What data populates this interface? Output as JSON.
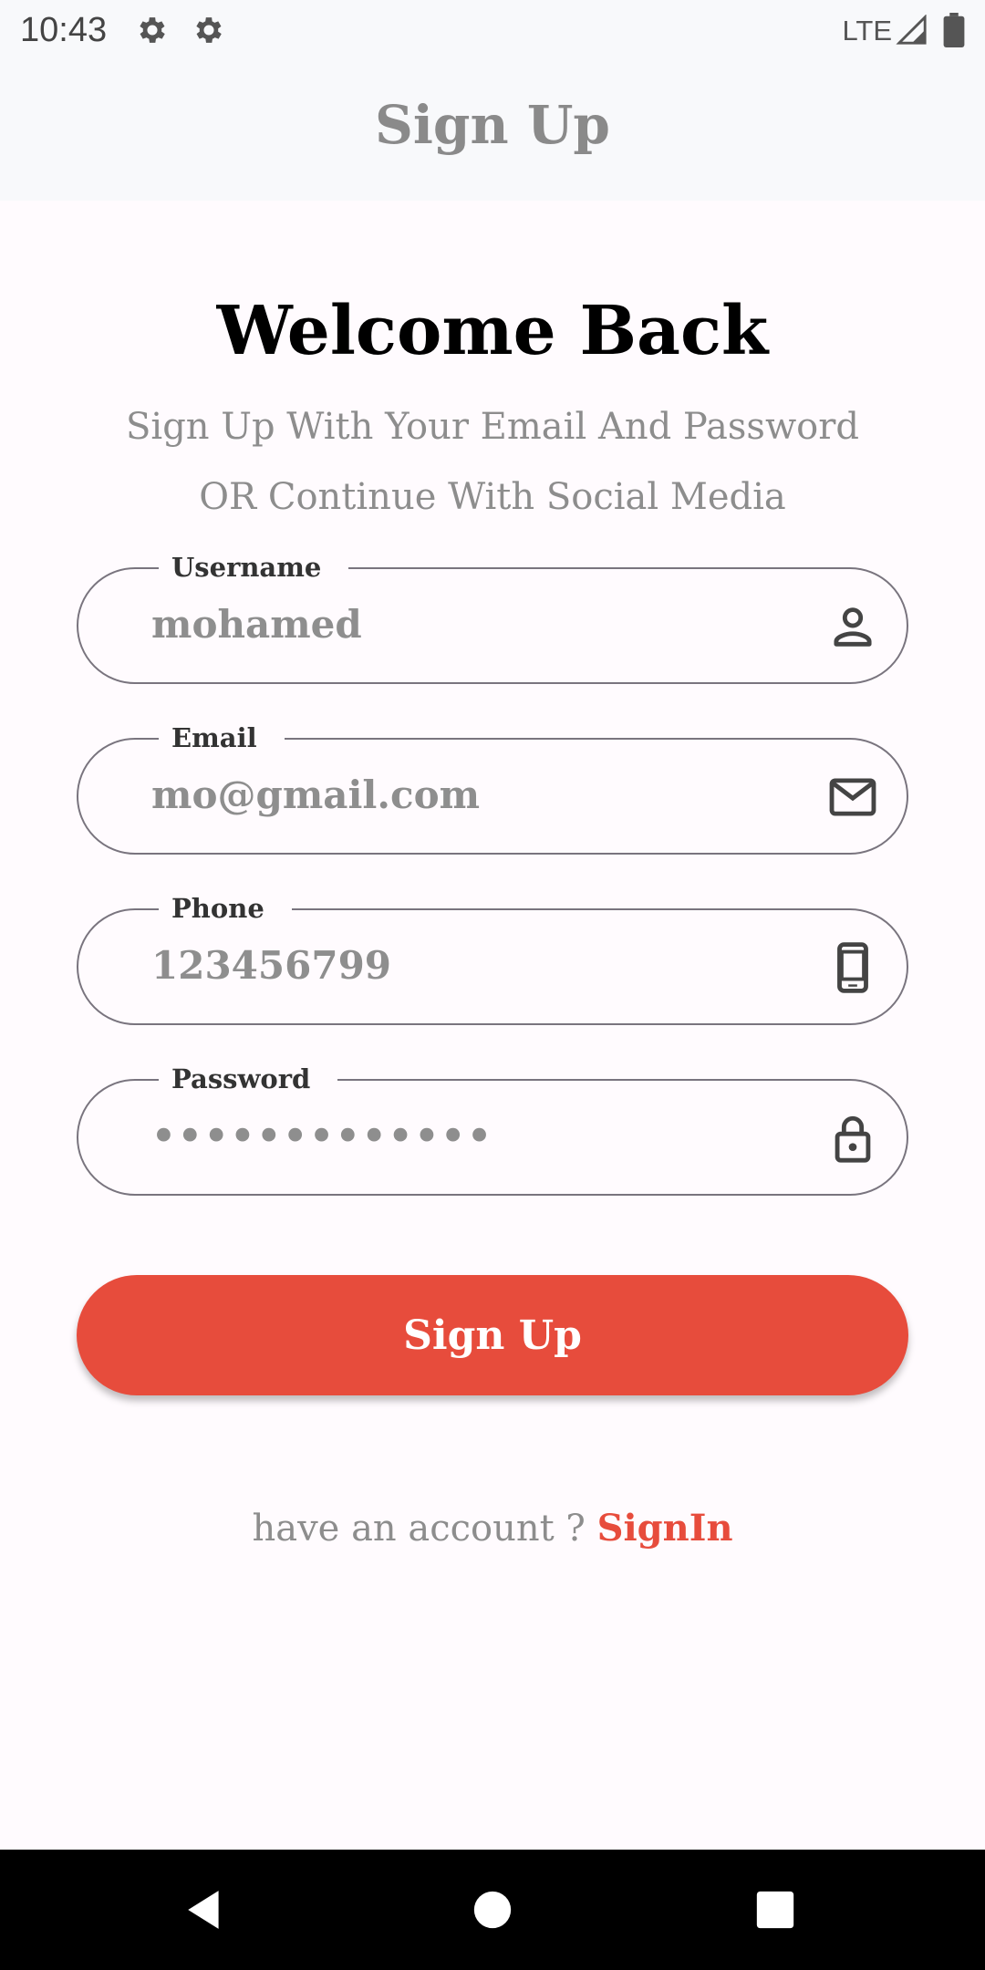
{
  "status": {
    "time": "10:43",
    "network": "LTE"
  },
  "app_bar": {
    "title": "Sign Up"
  },
  "welcome": {
    "title": "Welcome Back",
    "subtitle": "Sign Up With Your Email And Password OR Continue With Social Media"
  },
  "form": {
    "username": {
      "label": "Username",
      "value": "mohamed",
      "icon": "person-icon"
    },
    "email": {
      "label": "Email",
      "value": "mo@gmail.com",
      "icon": "mail-icon"
    },
    "phone": {
      "label": "Phone",
      "value": "123456799",
      "icon": "phone-icon"
    },
    "password": {
      "label": "Password",
      "value": "•••••••••••••",
      "icon": "lock-icon"
    }
  },
  "signup_button": {
    "label": "Sign Up"
  },
  "footer": {
    "prompt": "have an account ? ",
    "link": "SignIn"
  },
  "colors": {
    "accent": "#e74c3c",
    "appbar_bg": "#f8f9fb",
    "page_bg": "#fffbfe"
  }
}
